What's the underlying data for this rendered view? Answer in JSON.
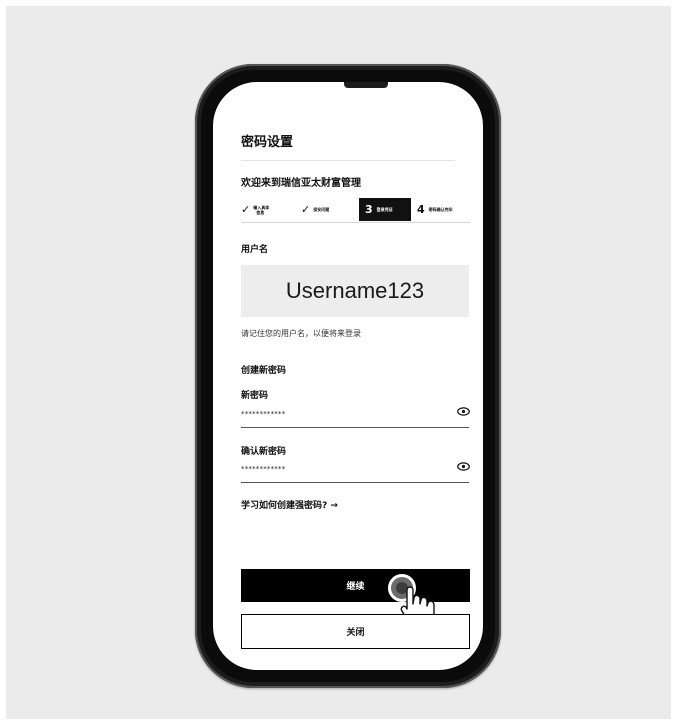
{
  "screen": {
    "title": "密码设置",
    "welcome": "欢迎来到瑞信亚太财富管理",
    "steps": [
      {
        "state": "done",
        "check": "✓",
        "label_line1": "输入具体",
        "label_line2": "信息"
      },
      {
        "state": "done",
        "check": "✓",
        "label": "保安问题"
      },
      {
        "state": "active",
        "number": "3",
        "label": "登录凭证"
      },
      {
        "state": "pending",
        "number": "4",
        "label": "密码确认完毕"
      }
    ],
    "username_label": "用户名",
    "username_value": "Username123",
    "username_note": "请记住您的用户名，以便将来登录",
    "create_password_heading": "创建新密码",
    "new_password_label": "新密码",
    "new_password_value": "************",
    "confirm_password_label": "确认新密码",
    "confirm_password_value": "************",
    "eye_icon": "eye-icon",
    "learn_link": "学习如何创建强密码? →",
    "continue_button": "继续",
    "close_button": "关闭",
    "colors": {
      "background": "#ebebeb",
      "phone": "#1c1c1c",
      "button": "#000000",
      "username_box": "#ededed"
    }
  }
}
